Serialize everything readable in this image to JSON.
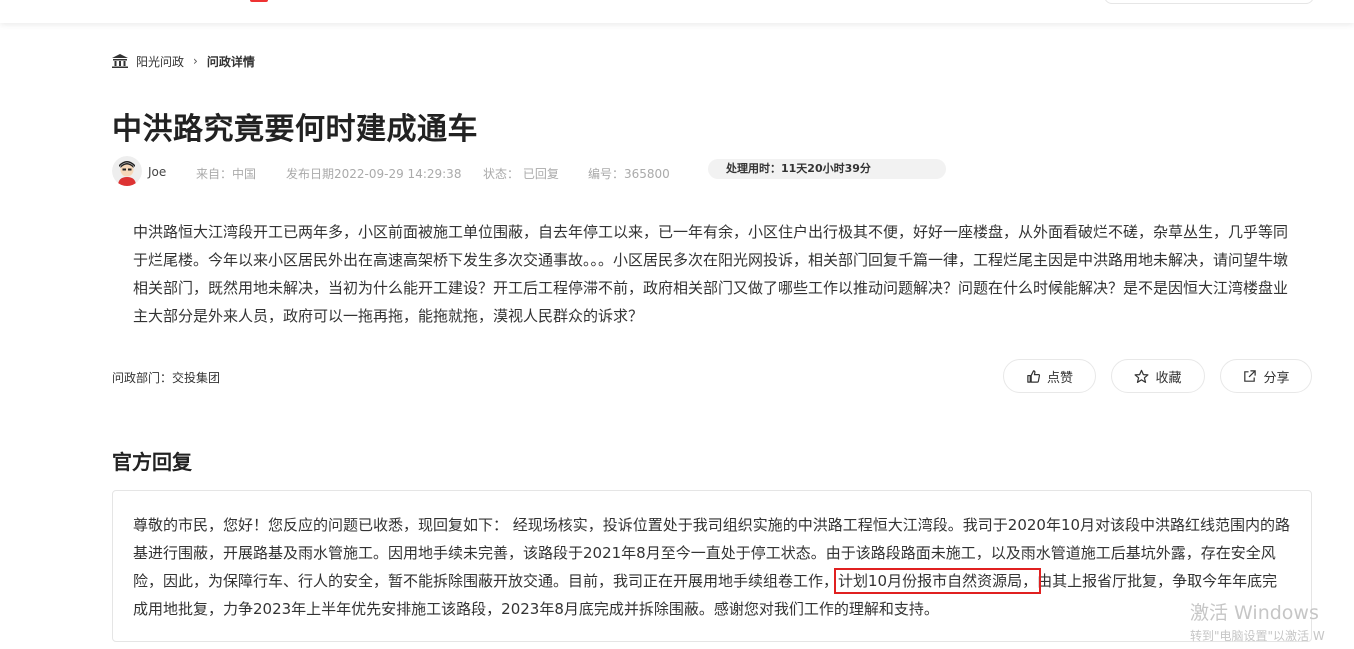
{
  "breadcrumb": {
    "home": "阳光问政",
    "separator": "›",
    "current": "问政详情"
  },
  "title": "中洪路究竟要何时建成通车",
  "meta": {
    "user": "Joe",
    "source": "来自：中国",
    "date": "发布日期2022-09-29 14:29:38",
    "status": "状态： 已回复",
    "number": "编号：365800",
    "processing_time": "处理用时：11天20小时39分"
  },
  "question": "中洪路恒大江湾段开工已两年多，小区前面被施工单位围蔽，自去年停工以来，已一年有余，小区住户出行极其不便，好好一座楼盘，从外面看破烂不磋，杂草丛生，几乎等同于烂尾楼。今年以来小区居民外出在高速高架桥下发生多次交通事故。。。小区居民多次在阳光网投诉，相关部门回复千篇一律，工程烂尾主因是中洪路用地未解决，请问望牛墩相关部门，既然用地未解决，当初为什么能开工建设？开工后工程停滞不前，政府相关部门又做了哪些工作以推动问题解决？问题在什么时候能解决？是不是因恒大江湾楼盘业主大部分是外来人员，政府可以一拖再拖，能拖就拖，漠视人民群众的诉求？",
  "department": "问政部门：交投集团",
  "actions": {
    "like": "点赞",
    "favorite": "收藏",
    "share": "分享"
  },
  "reply": {
    "heading": "官方回复",
    "text_before": "尊敬的市民，您好！您反应的问题已收悉，现回复如下： 经现场核实，投诉位置处于我司组织实施的中洪路工程恒大江湾段。我司于2020年10月对该段中洪路红线范围内的路基进行围蔽，开展路基及雨水管施工。因用地手续未完善，该路段于2021年8月至今一直处于停工状态。由于该路段路面未施工，以及雨水管道施工后基坑外露，存在安全风险，因此，为保障行车、行人的安全，暂不能拆除围蔽开放交通。目前，我司正在开展用地手续组卷工作，",
    "text_highlight": "计划10月份报市自然资源局，",
    "text_after": "由其上报省厅批复，争取今年年底完成用地批复，力争2023年上半年优先安排施工该路段，2023年8月底完成并拆除围蔽。感谢您对我们工作的理解和支持。"
  },
  "watermark": {
    "line1": "激活 Windows",
    "line2": "转到\"电脑设置\"以激活 W"
  },
  "colors": {
    "highlight_border": "#e02020",
    "pill_bg": "#f2f2f2"
  }
}
